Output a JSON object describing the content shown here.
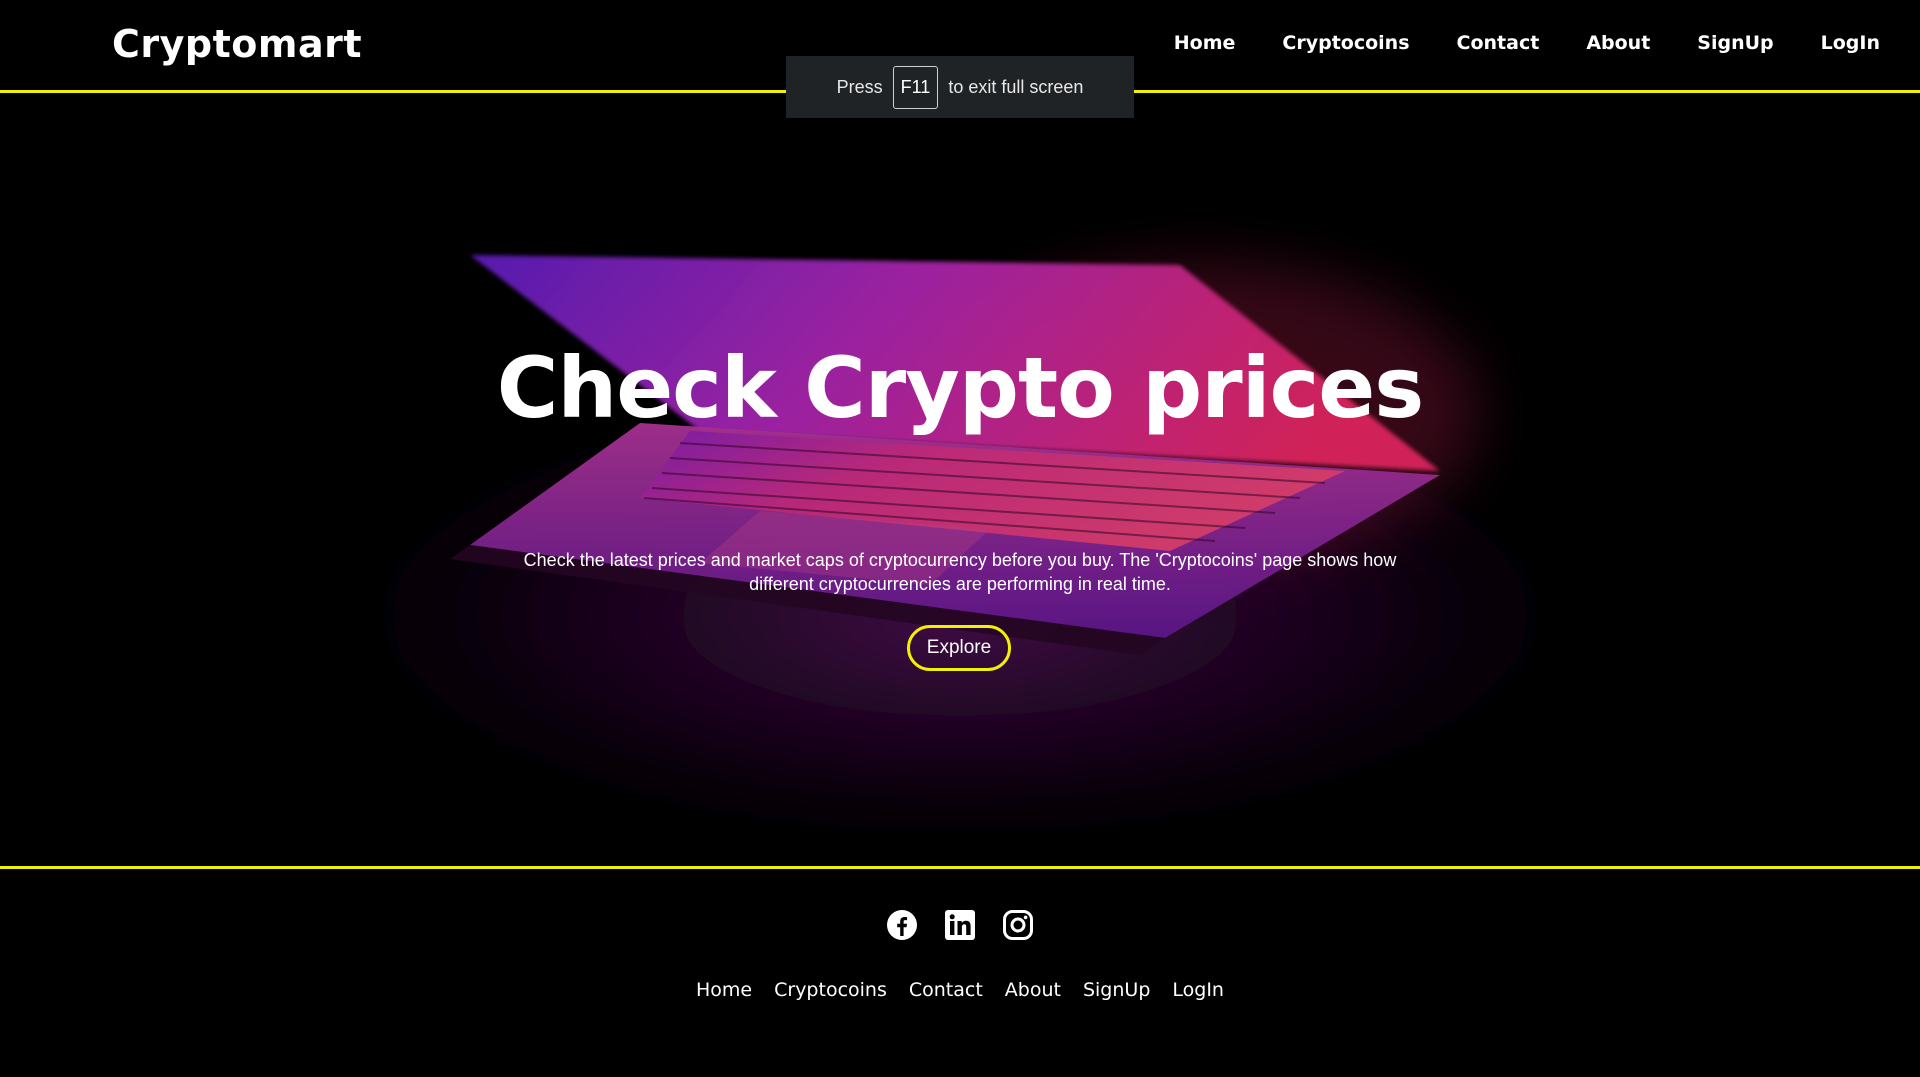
{
  "brand": "Cryptomart",
  "nav": [
    "Home",
    "Cryptocoins",
    "Contact",
    "About",
    "SignUp",
    "LogIn"
  ],
  "fullscreen_notice": {
    "prefix": "Press",
    "key": "F11",
    "suffix": "to exit full screen"
  },
  "hero": {
    "title": "Check Crypto prices",
    "description": "Check the latest prices and market caps of cryptocurrency before you buy. The 'Cryptocoins' page shows how different cryptocurrencies are performing in real time.",
    "button_label": "Explore"
  },
  "footer": {
    "social_icons": [
      "facebook-icon",
      "linkedin-icon",
      "instagram-icon"
    ],
    "nav": [
      "Home",
      "Cryptocoins",
      "Contact",
      "About",
      "SignUp",
      "LogIn"
    ]
  },
  "colors": {
    "accent": "#f2f200",
    "background": "#000000",
    "notice_bg": "#202325",
    "glow_pink": "#ff2a6d",
    "glow_purple": "#8a1bd6"
  }
}
